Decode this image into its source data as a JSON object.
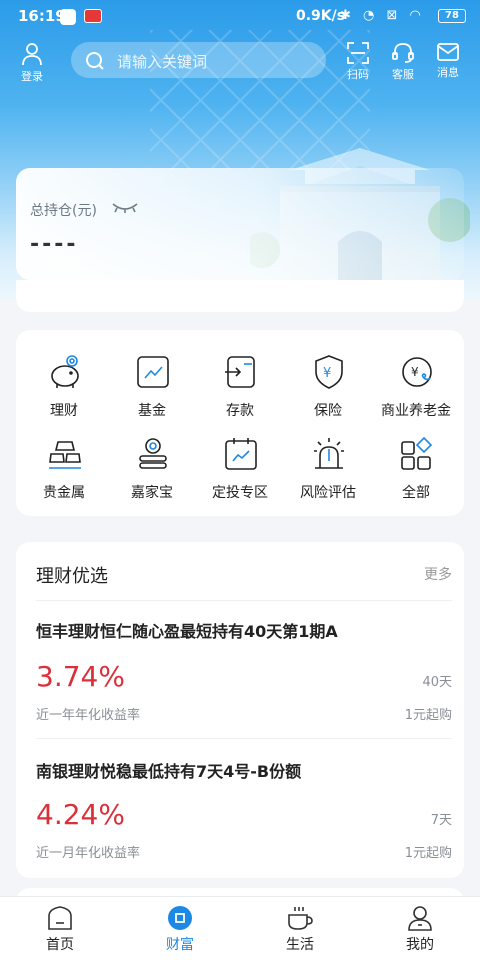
{
  "status_bar": {
    "time": "16:19",
    "network_speed": "0.9K/s",
    "battery": "78"
  },
  "top_bar": {
    "login_label": "登录",
    "search_placeholder": "请输入关键词",
    "scan_label": "扫码",
    "service_label": "客服",
    "message_label": "消息"
  },
  "holdings": {
    "label": "总持仓(元)",
    "value": "----"
  },
  "quick_menu": [
    {
      "label": "理财",
      "icon": "piggy-bank-icon"
    },
    {
      "label": "基金",
      "icon": "chart-icon"
    },
    {
      "label": "存款",
      "icon": "deposit-icon"
    },
    {
      "label": "保险",
      "icon": "shield-yen-icon"
    },
    {
      "label": "商业养老金",
      "icon": "pension-icon"
    },
    {
      "label": "贵金属",
      "icon": "gold-bars-icon"
    },
    {
      "label": "嘉家宝",
      "icon": "coin-stack-icon"
    },
    {
      "label": "定投专区",
      "icon": "calendar-chart-icon"
    },
    {
      "label": "风险评估",
      "icon": "lamp-icon"
    },
    {
      "label": "全部",
      "icon": "grid-icon"
    }
  ],
  "wealth_section": {
    "title": "理财优选",
    "more_label": "更多",
    "products": [
      {
        "name": "恒丰理财恒仁随心盈最短持有40天第1期A",
        "rate": "3.74%",
        "rate_desc": "近一年年化收益率",
        "term": "40天",
        "min_buy": "1元起购"
      },
      {
        "name": "南银理财悦稳最低持有7天4号-B份额",
        "rate": "4.24%",
        "rate_desc": "近一月年化收益率",
        "term": "7天",
        "min_buy": "1元起购"
      }
    ]
  },
  "tab_bar": {
    "tabs": [
      {
        "label": "首页"
      },
      {
        "label": "财富"
      },
      {
        "label": "生活"
      },
      {
        "label": "我的"
      }
    ],
    "active": "财富"
  },
  "colors": {
    "brand": "#1e88e5",
    "rate_red": "#d9303a"
  }
}
